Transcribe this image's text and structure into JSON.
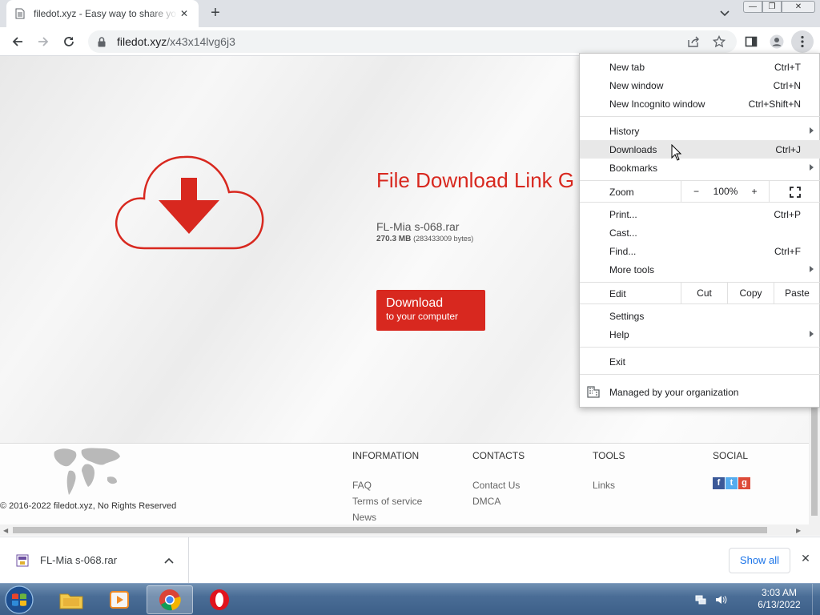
{
  "tab": {
    "title": "filedot.xyz - Easy way to share yo",
    "close": "✕",
    "new_tab": "+"
  },
  "window": {
    "minimize": "—",
    "maximize": "❐",
    "close": "✕"
  },
  "toolbar": {
    "url_host": "filedot.xyz",
    "url_path": "/x43x14lvg6j3"
  },
  "page": {
    "headline": "File Download Link G",
    "file_name": "FL-Mia s-068.rar",
    "file_size": "270.3 MB",
    "file_bytes": "(283433009 bytes)",
    "download_line1": "Download",
    "download_line2": "to your computer"
  },
  "footer": {
    "copyright": "© 2016-2022 filedot.xyz, No Rights Reserved",
    "information": {
      "heading": "INFORMATION",
      "links": [
        "FAQ",
        "Terms of service",
        "News"
      ]
    },
    "contacts": {
      "heading": "CONTACTS",
      "links": [
        "Contact Us",
        "DMCA"
      ]
    },
    "tools": {
      "heading": "TOOLS",
      "links": [
        "Links"
      ]
    },
    "social": {
      "heading": "SOCIAL",
      "icons": [
        "facebook-icon",
        "twitter-icon",
        "google-plus-icon"
      ]
    }
  },
  "shelf": {
    "file_name": "FL-Mia s-068.rar",
    "show_all": "Show all",
    "close": "✕"
  },
  "taskbar": {
    "time": "3:03 AM",
    "date": "6/13/2022"
  },
  "menu": {
    "new_tab": {
      "label": "New tab",
      "shortcut": "Ctrl+T"
    },
    "new_window": {
      "label": "New window",
      "shortcut": "Ctrl+N"
    },
    "new_incognito": {
      "label": "New Incognito window",
      "shortcut": "Ctrl+Shift+N"
    },
    "history": {
      "label": "History"
    },
    "downloads": {
      "label": "Downloads",
      "shortcut": "Ctrl+J"
    },
    "bookmarks": {
      "label": "Bookmarks"
    },
    "zoom": {
      "label": "Zoom",
      "minus": "−",
      "value": "100%",
      "plus": "+"
    },
    "print": {
      "label": "Print...",
      "shortcut": "Ctrl+P"
    },
    "cast": {
      "label": "Cast..."
    },
    "find": {
      "label": "Find...",
      "shortcut": "Ctrl+F"
    },
    "more_tools": {
      "label": "More tools"
    },
    "edit": {
      "label": "Edit",
      "cut": "Cut",
      "copy": "Copy",
      "paste": "Paste"
    },
    "settings": {
      "label": "Settings"
    },
    "help": {
      "label": "Help"
    },
    "exit": {
      "label": "Exit"
    },
    "managed": {
      "label": "Managed by your organization"
    }
  },
  "colors": {
    "brand_red": "#d8281f",
    "link_blue": "#1a73e8",
    "taskbar": "#4a6d96"
  }
}
